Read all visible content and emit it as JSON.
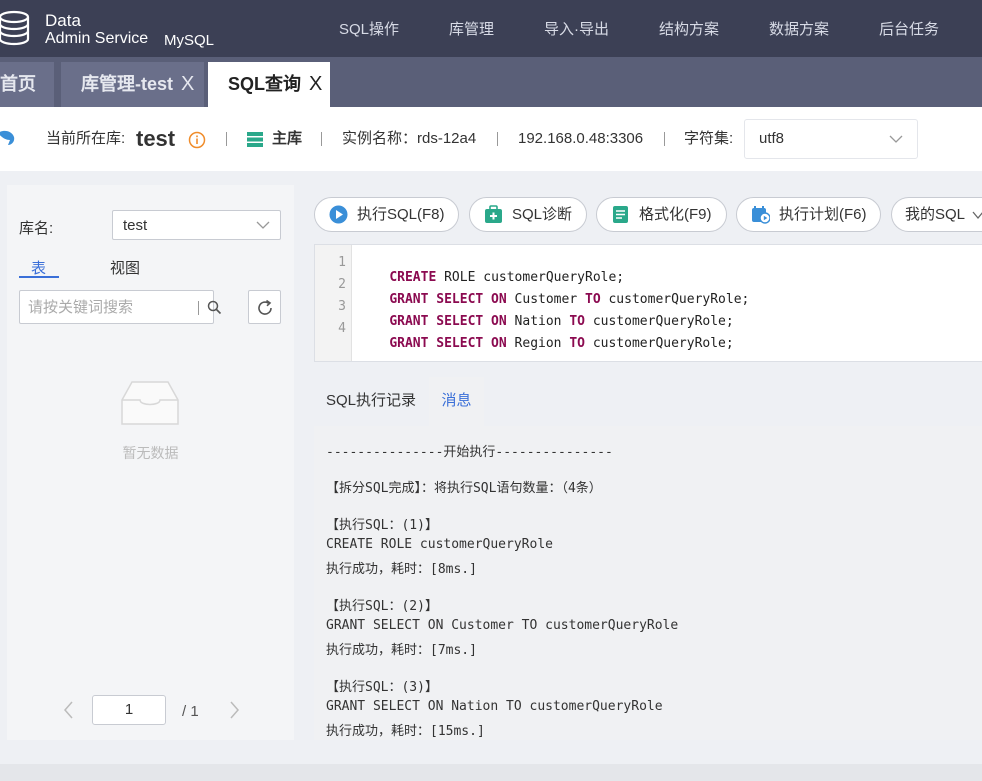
{
  "brand": {
    "line1": "Data",
    "line2": "Admin Service",
    "product": "MySQL"
  },
  "nav": [
    "SQL操作",
    "库管理",
    "导入·导出",
    "结构方案",
    "数据方案",
    "后台任务"
  ],
  "tabs": {
    "home": "首页",
    "lib": "库管理-test",
    "sql": "SQL查询",
    "close": "X"
  },
  "info": {
    "current_db_label": "当前所在库:",
    "db_name": "test",
    "role": "主库",
    "instance": "实例名称：rds-12a4",
    "address": "192.168.0.48:3306",
    "charset_label": "字符集:",
    "charset_value": "utf8"
  },
  "left": {
    "db_label": "库名:",
    "db_value": "test",
    "tab_table": "表",
    "tab_view": "视图",
    "search_placeholder": "请按关键词搜索",
    "empty_text": "暂无数据",
    "page": "1",
    "total": "/ 1"
  },
  "toolbar": {
    "run": "执行SQL(F8)",
    "diagnose": "SQL诊断",
    "format": "格式化(F9)",
    "plan": "执行计划(F6)",
    "mysql": "我的SQL"
  },
  "editor": {
    "line_numbers": [
      "1",
      "2",
      "3",
      "4"
    ],
    "lines": [
      [
        {
          "t": "CREATE",
          "k": true
        },
        {
          "t": " ROLE customerQueryRole;",
          "k": false
        }
      ],
      [
        {
          "t": "GRANT SELECT ON",
          "k": true
        },
        {
          "t": " Customer ",
          "k": false
        },
        {
          "t": "TO",
          "k": true
        },
        {
          "t": " customerQueryRole;",
          "k": false
        }
      ],
      [
        {
          "t": "GRANT SELECT ON",
          "k": true
        },
        {
          "t": " Nation ",
          "k": false
        },
        {
          "t": "TO",
          "k": true
        },
        {
          "t": " customerQueryRole;",
          "k": false
        }
      ],
      [
        {
          "t": "GRANT SELECT ON",
          "k": true
        },
        {
          "t": " Region ",
          "k": false
        },
        {
          "t": "TO",
          "k": true
        },
        {
          "t": " customerQueryRole;",
          "k": false
        }
      ]
    ]
  },
  "result_tabs": {
    "history": "SQL执行记录",
    "messages": "消息"
  },
  "messages": [
    "---------------开始执行---------------",
    "【拆分SQL完成】：将执行SQL语句数量：（4条）",
    "【执行SQL：(1)】",
    "CREATE ROLE customerQueryRole",
    "执行成功，耗时：[8ms.]",
    "【执行SQL：(2)】",
    "GRANT SELECT ON Customer TO customerQueryRole",
    "执行成功，耗时：[7ms.]",
    "【执行SQL：(3)】",
    "GRANT SELECT ON Nation TO customerQueryRole",
    "执行成功，耗时：[15ms.]"
  ],
  "colors": {
    "nav_bg": "#3c4055",
    "tab_bg": "#5a5f78",
    "accent": "#3a6fd8",
    "keyword": "#8b0a50",
    "info_icon": "#f08c2a"
  }
}
